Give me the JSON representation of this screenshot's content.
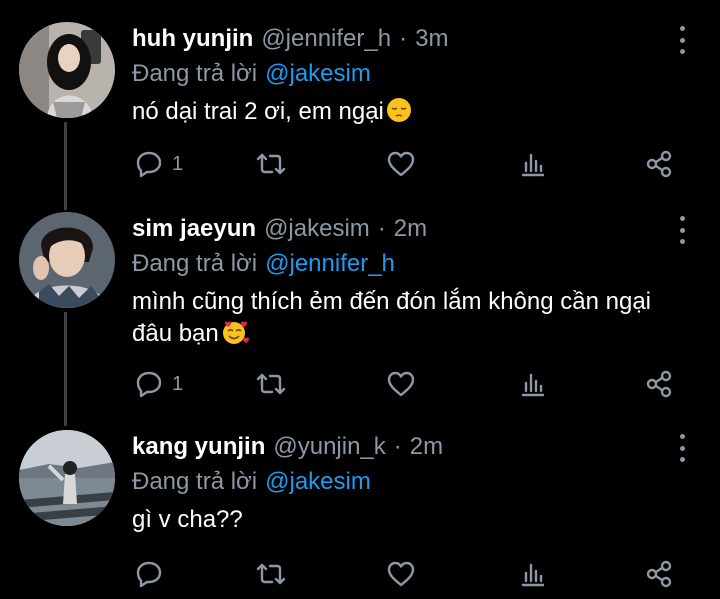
{
  "tweets": [
    {
      "name": "huh yunjin",
      "handle": "@jennifer_h",
      "separator": "·",
      "time": "3m",
      "reply_prefix": "Đang trả lời",
      "reply_to": "@jakesim",
      "text": "nó dại trai 2 ơi, em ngại",
      "emoji": "pensive-face",
      "reply_count": "1"
    },
    {
      "name": "sim jaeyun",
      "handle": "@jakesim",
      "separator": "·",
      "time": "2m",
      "reply_prefix": "Đang trả lời",
      "reply_to": "@jennifer_h",
      "text": "mình cũng thích ẻm đến đón lắm không cần ngại đâu bạn",
      "emoji": "smiling-face-with-hearts",
      "reply_count": "1"
    },
    {
      "name": "kang yunjin",
      "handle": "@yunjin_k",
      "separator": "·",
      "time": "2m",
      "reply_prefix": "Đang trả lời",
      "reply_to": "@jakesim",
      "text": "gì v cha??",
      "emoji": "",
      "reply_count": ""
    }
  ],
  "icons": [
    "reply-icon",
    "retweet-icon",
    "like-icon",
    "views-icon",
    "share-icon",
    "more-icon"
  ],
  "colors": {
    "background": "#000000",
    "text": "#ffffff",
    "secondary": "#8b98a5",
    "mention": "#1d9bf0",
    "thread_line": "#3b4046"
  }
}
